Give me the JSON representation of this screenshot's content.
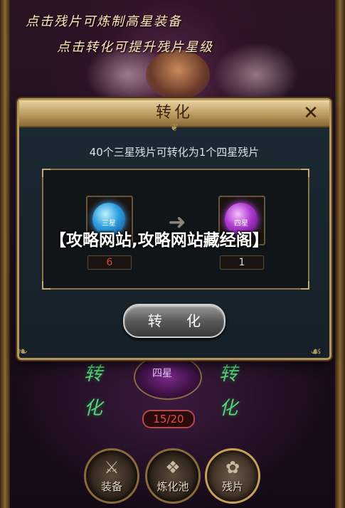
{
  "hints": {
    "line1": "点击残片可炼制高星装备",
    "line2": "点击转化可提升残片星级"
  },
  "dialog": {
    "title": "转化",
    "close_icon": "close-icon",
    "description": "40个三星残片可转化为1个四星残片",
    "from_gem": {
      "label": "三星",
      "quantity": "6",
      "icon": "blue-gem-icon"
    },
    "to_gem": {
      "label": "四星",
      "quantity": "1",
      "icon": "purple-gem-icon"
    },
    "arrow_icon": "arrow-right-icon",
    "convert_button": "转 化"
  },
  "background": {
    "left_convert": "转化",
    "right_convert": "转化",
    "center_label": "四星",
    "progress": "15/20"
  },
  "tabs": [
    {
      "label": "装备",
      "icon": "swords-icon"
    },
    {
      "label": "炼化池",
      "icon": "cauldron-icon"
    },
    {
      "label": "残片",
      "icon": "shard-icon"
    }
  ],
  "banner": {
    "text": "【攻略网站,攻略网站藏经阁】"
  },
  "colors": {
    "accent_gold": "#b4965e",
    "warning_red": "#e04040",
    "hint_text": "#ffe7b8"
  }
}
